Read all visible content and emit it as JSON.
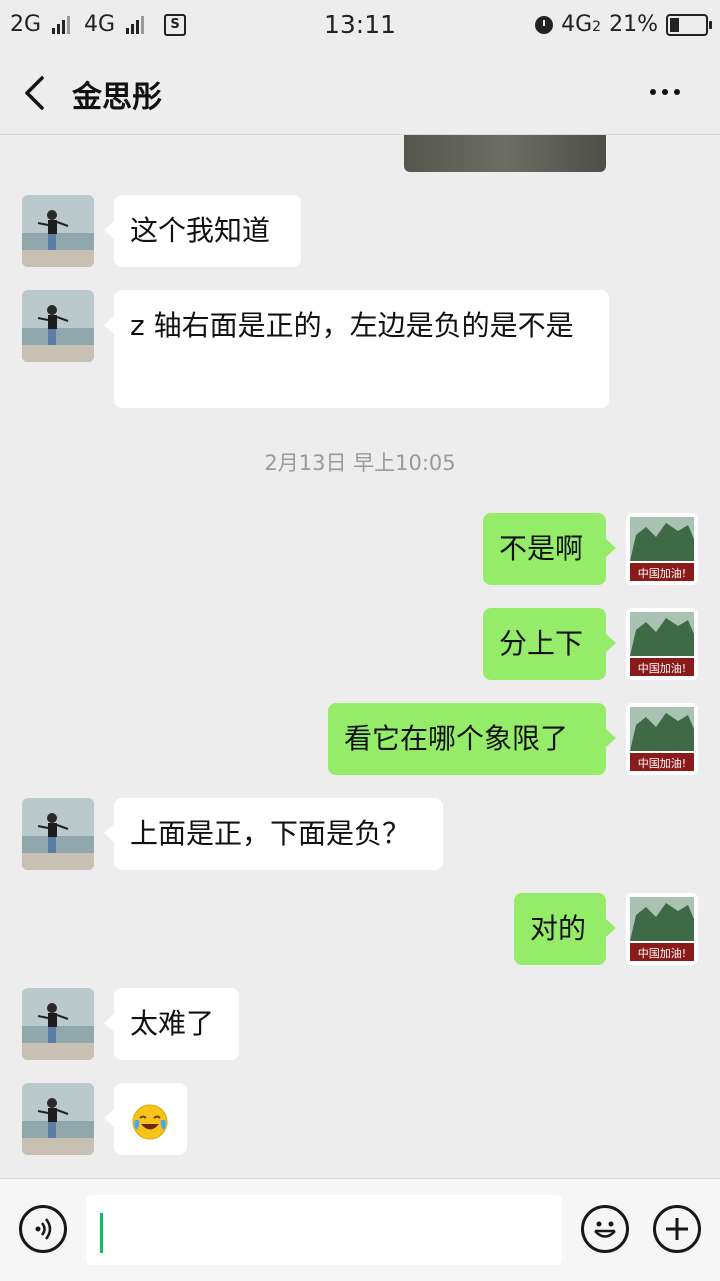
{
  "status_bar": {
    "net1": "2G",
    "net2": "4G",
    "sim_icon": "S",
    "time": "13:11",
    "net3": "4G",
    "net3_sub": "2",
    "battery": "21%"
  },
  "nav": {
    "title": "金思彤"
  },
  "messages": [
    {
      "side": "in",
      "text": "这个我知道"
    },
    {
      "side": "in",
      "text": "z 轴右面是正的，左边是负的是不是"
    },
    {
      "side": "out",
      "text": "不是啊"
    },
    {
      "side": "out",
      "text": "分上下"
    },
    {
      "side": "out",
      "text": "看它在哪个象限了"
    },
    {
      "side": "in",
      "text": "上面是正，下面是负？"
    },
    {
      "side": "out",
      "text": "对的"
    },
    {
      "side": "in",
      "text": "太难了"
    },
    {
      "side": "in",
      "emoji": "crying-laughing-emoji"
    }
  ],
  "timestamp": "2月13日 早上10:05",
  "my_avatar_caption": "中国加油!",
  "colors": {
    "background": "#ededed",
    "outgoing_bubble": "#95ec69",
    "incoming_bubble": "#ffffff",
    "caret": "#07c160"
  }
}
